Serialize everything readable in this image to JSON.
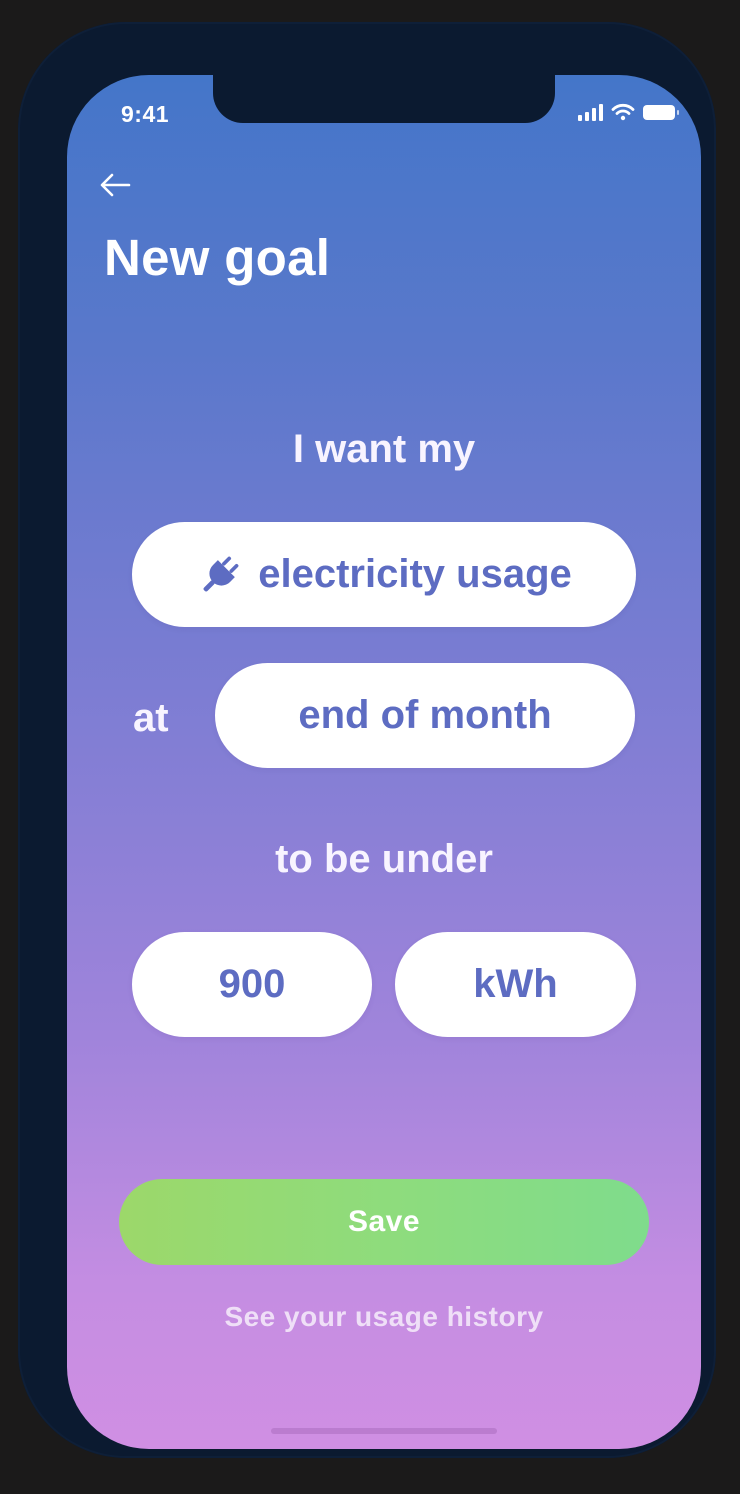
{
  "status_bar": {
    "time": "9:41",
    "icons": [
      "signal-icon",
      "wifi-icon",
      "battery-icon"
    ]
  },
  "header": {
    "back_icon": "arrow-left-icon",
    "title": "New goal"
  },
  "form": {
    "intro": "I want my",
    "metric": {
      "icon": "plug-icon",
      "label": "electricity usage"
    },
    "at_label": "at",
    "timeframe": "end of month",
    "condition": "to be under",
    "amount": "900",
    "unit": "kWh"
  },
  "actions": {
    "save_label": "Save",
    "history_link": "See your usage history"
  },
  "colors": {
    "gradient_top": "#4476c9",
    "gradient_bottom": "#d08fe3",
    "pill_text": "#5d6cc2",
    "save_start": "#9cd86a",
    "save_end": "#7fdc8c",
    "device_frame": "#0b1a30"
  }
}
